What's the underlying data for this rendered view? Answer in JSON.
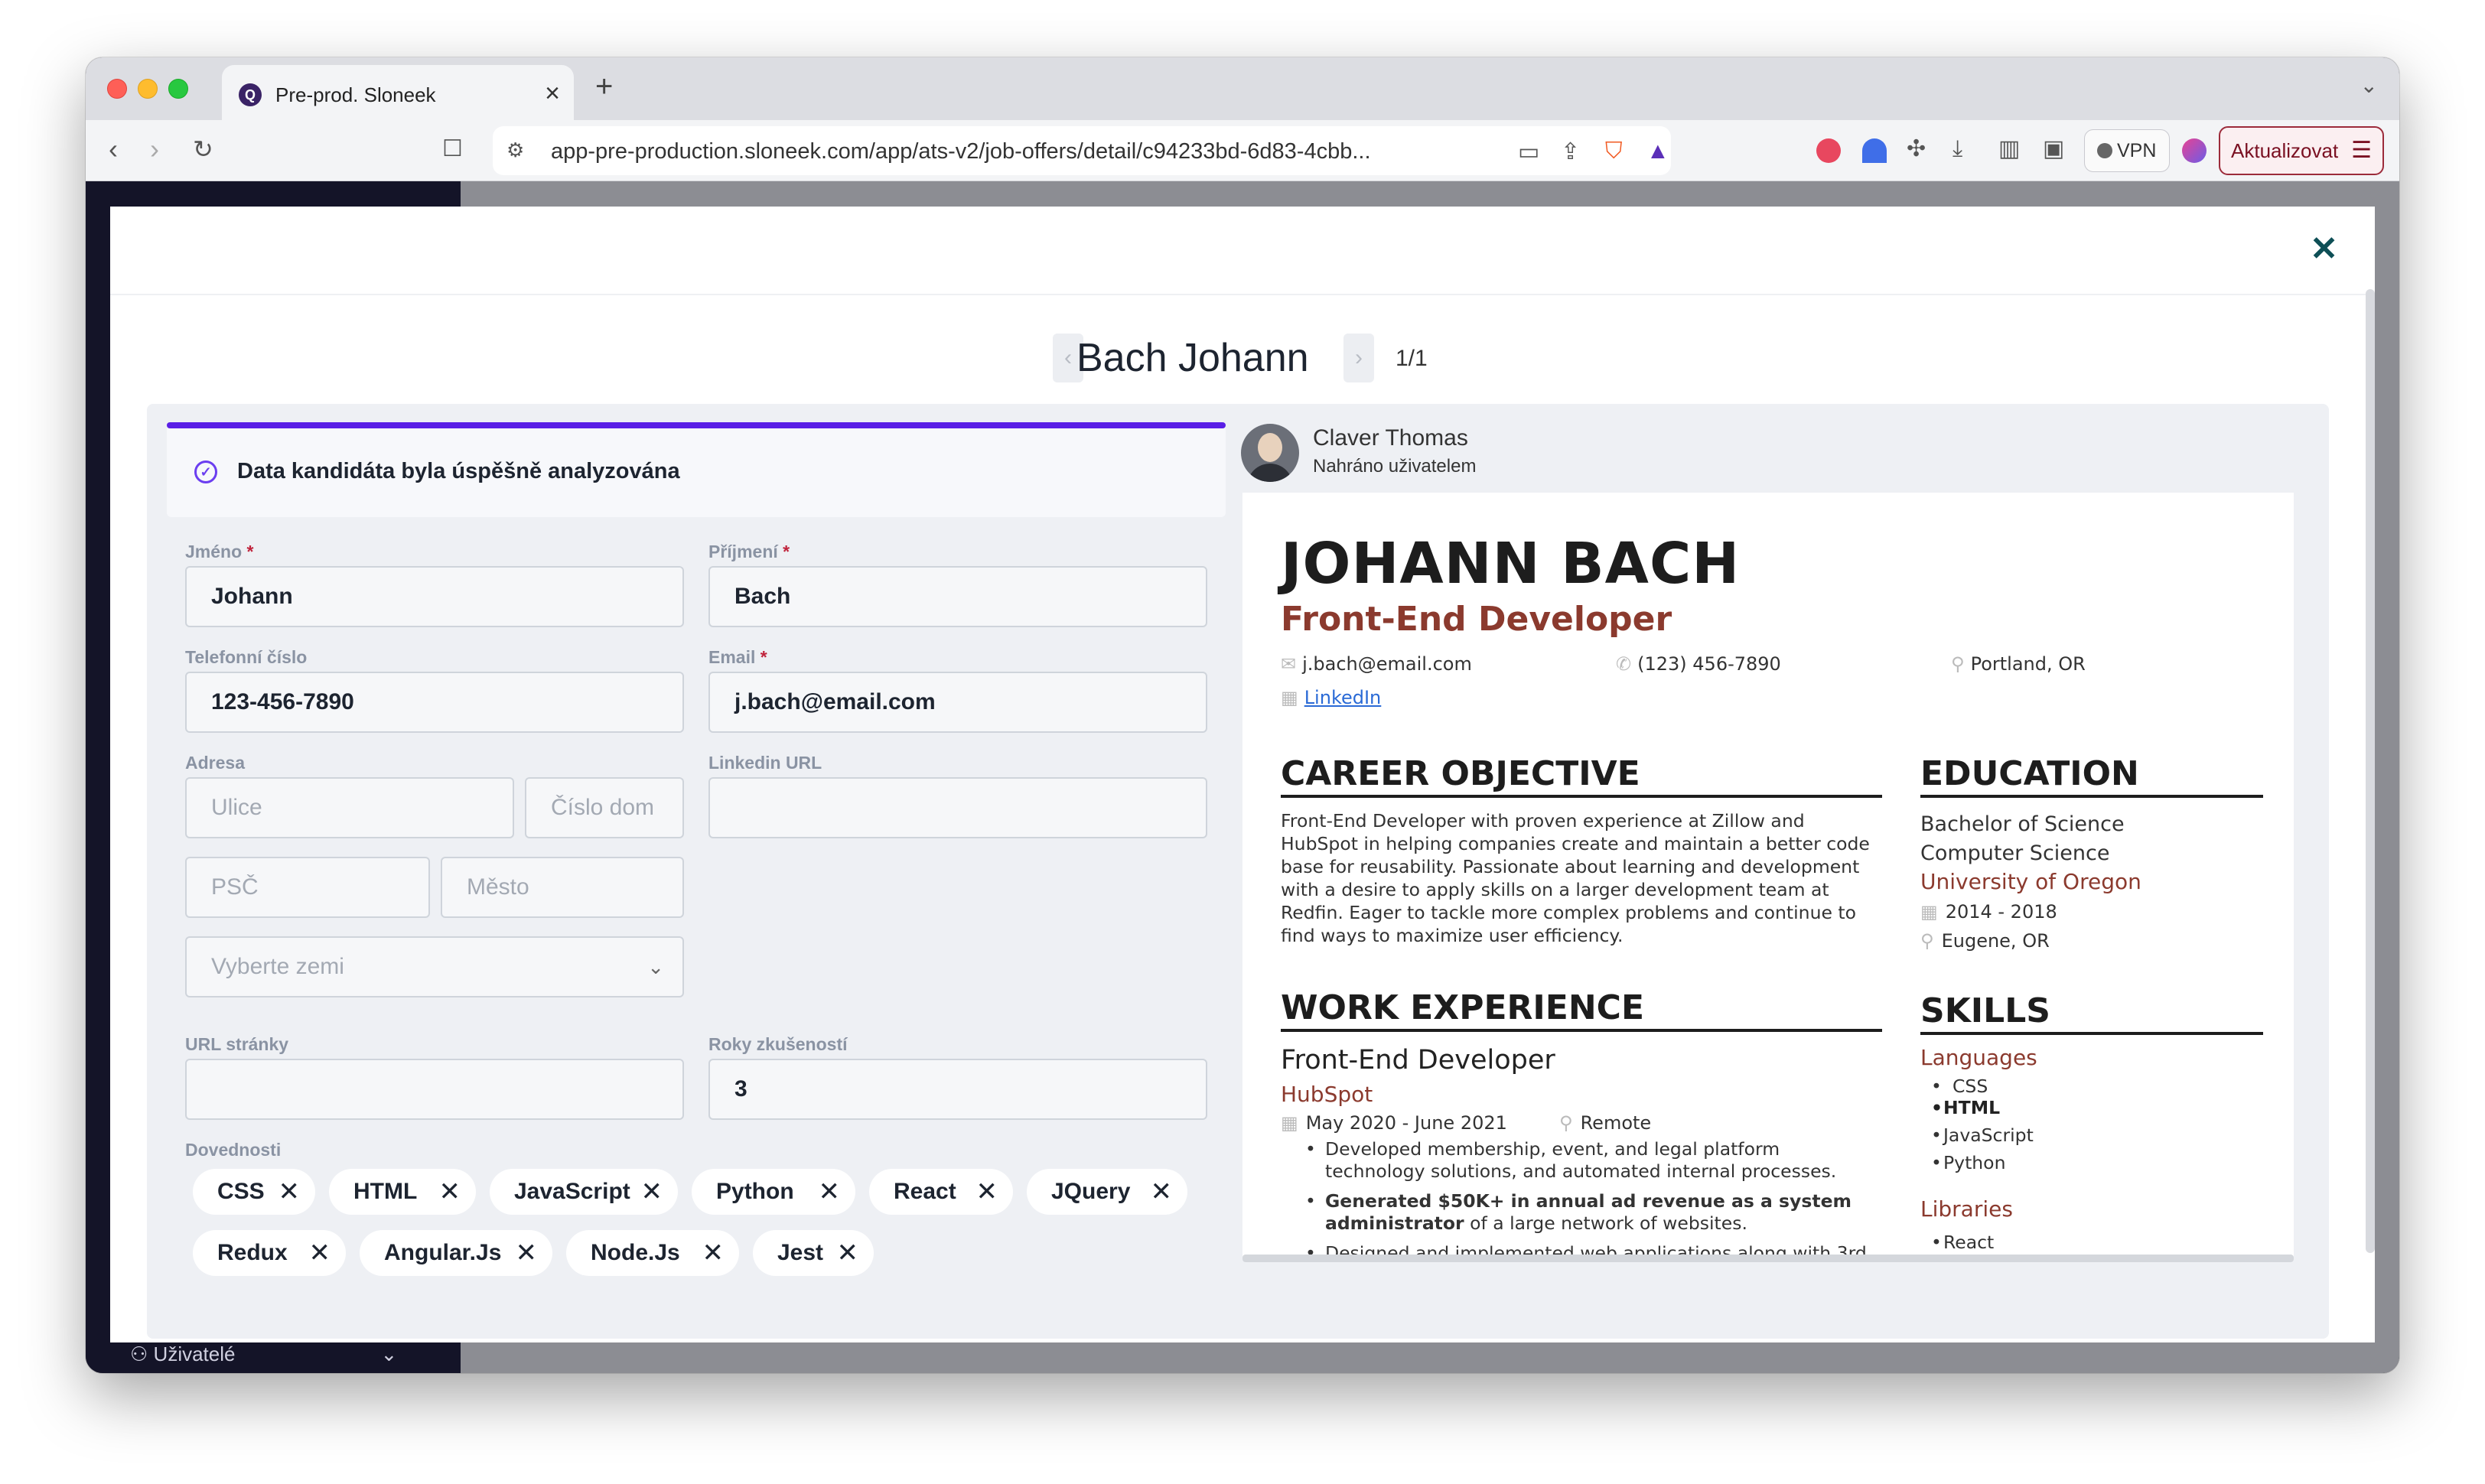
{
  "browser": {
    "tab_title": "Pre-prod. Sloneek",
    "tab_favicon": "Q",
    "url": "app-pre-production.sloneek.com/app/ats-v2/job-offers/detail/c94233bd-6d83-4cbb...",
    "vpn_label": "VPN",
    "update_label": "Aktualizovat"
  },
  "sidebar": {
    "users_label": "Uživatelé"
  },
  "modal": {
    "candidate_name": "Bach Johann",
    "counter": "1/1",
    "success_message": "Data kandidáta byla úspěšně analyzována",
    "fields": {
      "first_name_label": "Jméno",
      "first_name_value": "Johann",
      "last_name_label": "Příjmení",
      "last_name_value": "Bach",
      "phone_label": "Telefonní číslo",
      "phone_value": "123-456-7890",
      "email_label": "Email",
      "email_value": "j.bach@email.com",
      "address_label": "Adresa",
      "street_placeholder": "Ulice",
      "house_placeholder": "Číslo dom",
      "zip_placeholder": "PSČ",
      "city_placeholder": "Město",
      "country_placeholder": "Vyberte zemi",
      "linkedin_label": "Linkedin URL",
      "linkedin_value": "",
      "website_label": "URL stránky",
      "website_value": "",
      "experience_label": "Roky zkušeností",
      "experience_value": "3",
      "skills_label": "Dovednosti",
      "required_mark": "*"
    },
    "skills": [
      "CSS",
      "HTML",
      "JavaScript",
      "Python",
      "React",
      "JQuery",
      "Redux",
      "Angular.Js",
      "Node.Js",
      "Jest"
    ],
    "uploader": {
      "name": "Claver Thomas",
      "subtitle": "Nahráno uživatelem"
    }
  },
  "resume": {
    "name": "JOHANN BACH",
    "role": "Front-End Developer",
    "email": "j.bach@email.com",
    "phone": "(123) 456-7890",
    "location": "Portland, OR",
    "linkedin": "LinkedIn",
    "career_heading": "CAREER OBJECTIVE",
    "career_text": "Front-End Developer with proven experience at Zillow and HubSpot in helping companies create and maintain a better code base for reusability. Passionate about learning and development with a desire to apply skills on a larger development team at Redfin. Eager to tackle more complex problems and continue to find ways to maximize user efficiency.",
    "work_heading": "WORK EXPERIENCE",
    "job_title": "Front-End Developer",
    "job_company": "HubSpot",
    "job_dates": "May 2020 - June 2021",
    "job_location": "Remote",
    "job_bullet_1": "Developed membership, event, and legal platform technology solutions, and automated internal processes.",
    "job_bullet_2_bold": "Generated $50K+ in annual ad revenue as a system administrator",
    "job_bullet_2_rest": " of a large network of websites.",
    "job_bullet_3": "Designed and implemented web applications along with 3rd",
    "education_heading": "EDUCATION",
    "degree": "Bachelor of Science",
    "major": "Computer Science",
    "school": "University of Oregon",
    "edu_dates": "2014 - 2018",
    "edu_location": "Eugene, OR",
    "skills_heading": "SKILLS",
    "languages_heading": "Languages",
    "languages": [
      "CSS",
      "HTML",
      "JavaScript",
      "Python"
    ],
    "libraries_heading": "Libraries",
    "libraries_first": "React"
  },
  "colors": {
    "accent_purple": "#5a1fe6",
    "resume_accent": "#8b3a2e",
    "close_teal": "#0e4f56",
    "update_red": "#9c2b3a"
  },
  "icons": {
    "close": "×",
    "chevron_left": "‹",
    "chevron_right": "›",
    "chip_remove": "✕",
    "dropdown": "chevron-down-icon"
  }
}
